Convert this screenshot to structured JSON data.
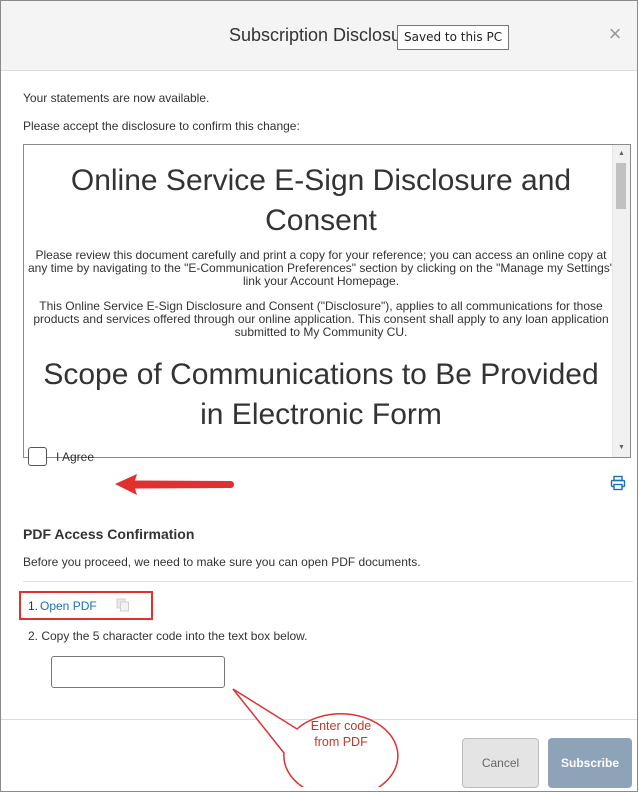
{
  "dialog": {
    "title": "Subscription Disclosure",
    "close_icon": "close-icon",
    "close_glyph": "×"
  },
  "tooltip": {
    "text": "Saved to this PC"
  },
  "intro": {
    "line1": "Your statements are now available.",
    "line2": "Please accept the disclosure to confirm this change:"
  },
  "document": {
    "heading1": "Online Service E-Sign Disclosure and Consent",
    "paragraph1": "Please review this document carefully and print a copy for your reference; you can access an online copy at any time by   navigating to the \"E-Communication Preferences\" section by clicking on the \"Manage my Settings\" link your Account   Homepage.",
    "paragraph2": "This Online Service E-Sign Disclosure and Consent (\"Disclosure\"), applies to all communications for those products and   services offered through our online application. This consent shall apply to any loan application submitted to My Community  CU.",
    "heading2": "Scope of Communications to Be Provided in Electronic Form"
  },
  "agree": {
    "label": "I Agree",
    "checked": false
  },
  "pdf_section": {
    "title": "PDF Access Confirmation",
    "description": "Before you proceed, we need to make sure you can open PDF documents.",
    "step1_number": "1.",
    "step1_link": "Open PDF",
    "step2": "2. Copy the 5 character code into the text box below.",
    "code_value": "",
    "code_placeholder": ""
  },
  "annotation": {
    "callout_text": "Enter code from PDF",
    "annotation_color": "#e03030"
  },
  "footer": {
    "cancel_label": "Cancel",
    "subscribe_label": "Subscribe"
  },
  "colors": {
    "link": "#1a6fb5",
    "subscribe_bg": "#8ea3b8",
    "header_bg": "#f4f4f4"
  }
}
